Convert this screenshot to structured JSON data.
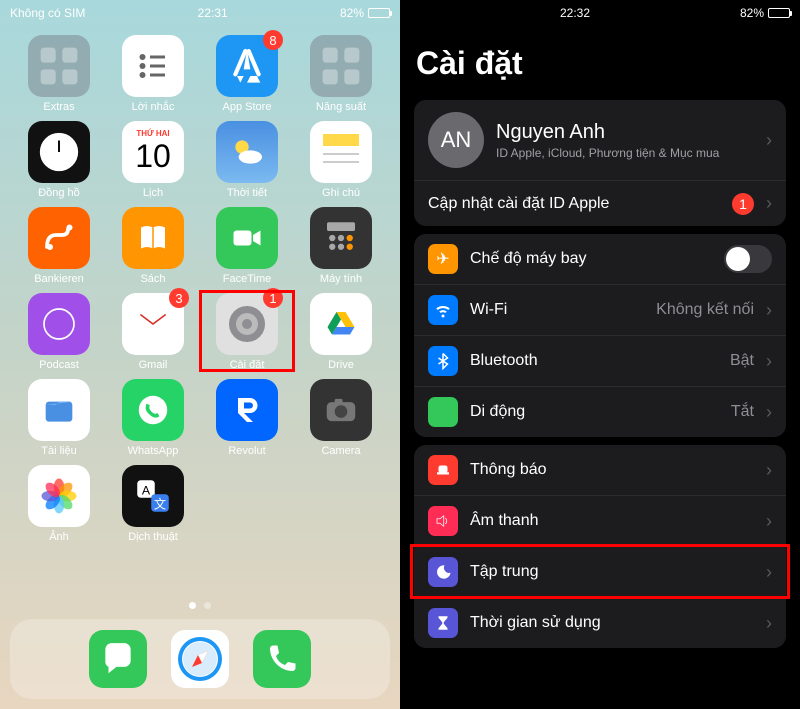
{
  "left": {
    "status": {
      "carrier": "Không có SIM",
      "time": "22:31",
      "battery": "82%"
    },
    "apps": [
      {
        "label": "Extras",
        "icon": "folder",
        "cls": "i-folder"
      },
      {
        "label": "Lời nhắc",
        "icon": "list",
        "cls": "i-rem"
      },
      {
        "label": "App Store",
        "icon": "as",
        "cls": "i-as",
        "badge": "8"
      },
      {
        "label": "Năng suất",
        "icon": "folder",
        "cls": "i-folder"
      },
      {
        "label": "Đồng hồ",
        "icon": "clock",
        "cls": "i-clock"
      },
      {
        "label": "Lịch",
        "icon": "cal",
        "cls": "i-cal",
        "top": "THỨ HAI",
        "day": "10"
      },
      {
        "label": "Thời tiết",
        "icon": "wea",
        "cls": "i-wea"
      },
      {
        "label": "Ghi chú",
        "icon": "note",
        "cls": "i-note"
      },
      {
        "label": "Bankieren",
        "icon": "ing",
        "cls": "i-ing"
      },
      {
        "label": "Sách",
        "icon": "book",
        "cls": "i-book"
      },
      {
        "label": "FaceTime",
        "icon": "ft",
        "cls": "i-ft"
      },
      {
        "label": "Máy tính",
        "icon": "calc",
        "cls": "i-calc"
      },
      {
        "label": "Podcast",
        "icon": "pod",
        "cls": "i-pod"
      },
      {
        "label": "Gmail",
        "icon": "gm",
        "cls": "i-gm",
        "badge": "3"
      },
      {
        "label": "Cài đặt",
        "icon": "set",
        "cls": "i-set",
        "badge": "1",
        "highlight": true
      },
      {
        "label": "Drive",
        "icon": "drive",
        "cls": "i-drive"
      },
      {
        "label": "Tài liệu",
        "icon": "file",
        "cls": "i-file"
      },
      {
        "label": "WhatsApp",
        "icon": "wa",
        "cls": "i-wa"
      },
      {
        "label": "Revolut",
        "icon": "rev",
        "cls": "i-rev"
      },
      {
        "label": "Camera",
        "icon": "cam",
        "cls": "i-cam"
      },
      {
        "label": "Ảnh",
        "icon": "photo",
        "cls": "i-photo"
      },
      {
        "label": "Dịch thuật",
        "icon": "trans",
        "cls": "i-trans"
      }
    ],
    "dock": [
      {
        "label": "Messages",
        "cls": "i-msg"
      },
      {
        "label": "Safari",
        "cls": "i-saf"
      },
      {
        "label": "Phone",
        "cls": "i-phone"
      }
    ]
  },
  "right": {
    "status": {
      "time": "22:32",
      "battery": "82%"
    },
    "title": "Cài đặt",
    "profile": {
      "initials": "AN",
      "name": "Nguyen Anh",
      "sub": "ID Apple, iCloud, Phương tiện & Mục mua"
    },
    "update": {
      "label": "Cập nhật cài đặt ID Apple",
      "badge": "1"
    },
    "group1": [
      {
        "label": "Chế độ máy bay",
        "icon": "✈",
        "bg": "#ff9500",
        "type": "toggle"
      },
      {
        "label": "Wi-Fi",
        "icon": "wifi",
        "bg": "#007aff",
        "val": "Không kết nối"
      },
      {
        "label": "Bluetooth",
        "icon": "bt",
        "bg": "#007aff",
        "val": "Bật"
      },
      {
        "label": "Di động",
        "icon": "ant",
        "bg": "#34c759",
        "val": "Tắt"
      }
    ],
    "group2": [
      {
        "label": "Thông báo",
        "icon": "bell",
        "bg": "#ff3b30"
      },
      {
        "label": "Âm thanh",
        "icon": "vol",
        "bg": "#ff2d55"
      },
      {
        "label": "Tập trung",
        "icon": "moon",
        "bg": "#5856d6",
        "highlight": true
      },
      {
        "label": "Thời gian sử dụng",
        "icon": "hg",
        "bg": "#5856d6"
      }
    ]
  }
}
